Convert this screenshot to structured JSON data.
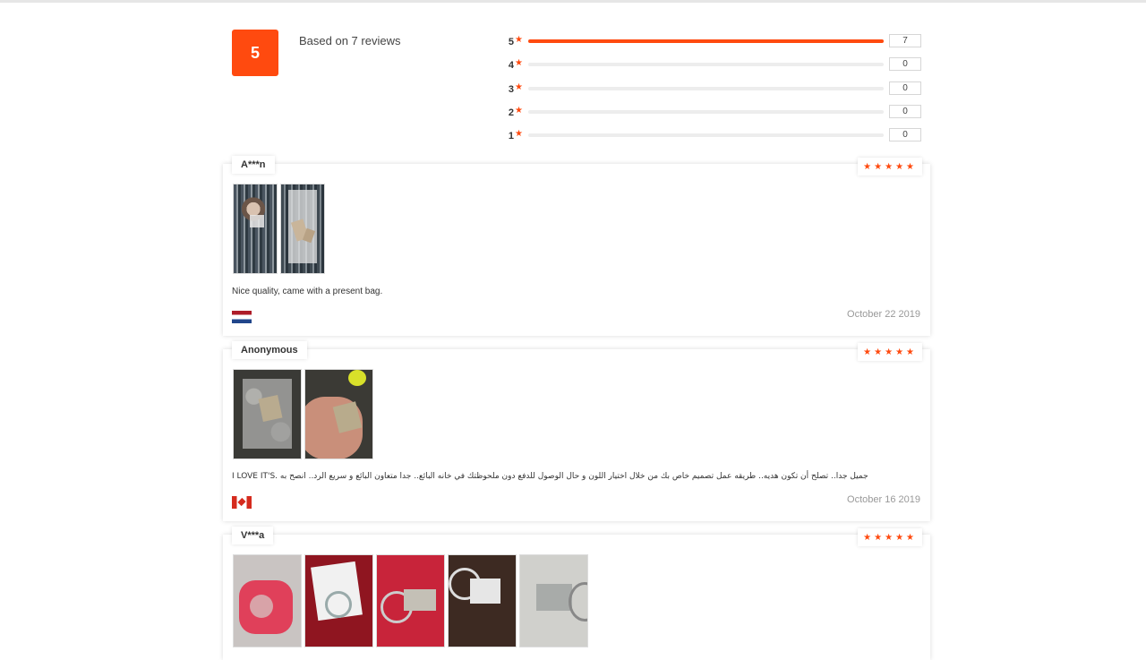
{
  "summary": {
    "average": "5",
    "based_on": "Based on 7 reviews",
    "distribution": [
      {
        "stars": "5",
        "count": "7",
        "fraction": 1.0
      },
      {
        "stars": "4",
        "count": "0",
        "fraction": 0
      },
      {
        "stars": "3",
        "count": "0",
        "fraction": 0
      },
      {
        "stars": "2",
        "count": "0",
        "fraction": 0
      },
      {
        "stars": "1",
        "count": "0",
        "fraction": 0
      }
    ]
  },
  "reviews": [
    {
      "author": "A***n",
      "rating": 5,
      "stars": "★★★★★",
      "text": "Nice quality, came with a present bag.",
      "date": "October 22 2019",
      "country": "Netherlands",
      "photos": 2
    },
    {
      "author": "Anonymous",
      "rating": 5,
      "stars": "★★★★★",
      "text": "I LOVE IT'S. جميل جدا.. تصلح أن تكون هديه.. طريقه عمل تصميم خاص بك من خلال اختيار اللون و حال الوصول للدفع دون ملحوظتك في خانه البائع.. جدا متعاون البائع و سريع الرد.. انصح به",
      "date": "October 16 2019",
      "country": "Canada",
      "photos": 2
    },
    {
      "author": "V***a",
      "rating": 5,
      "stars": "★★★★★",
      "text": "",
      "date": "",
      "country": "",
      "photos": 5
    }
  ],
  "colors": {
    "accent": "#ff4a0f",
    "track": "#ededed",
    "date": "#999999"
  }
}
